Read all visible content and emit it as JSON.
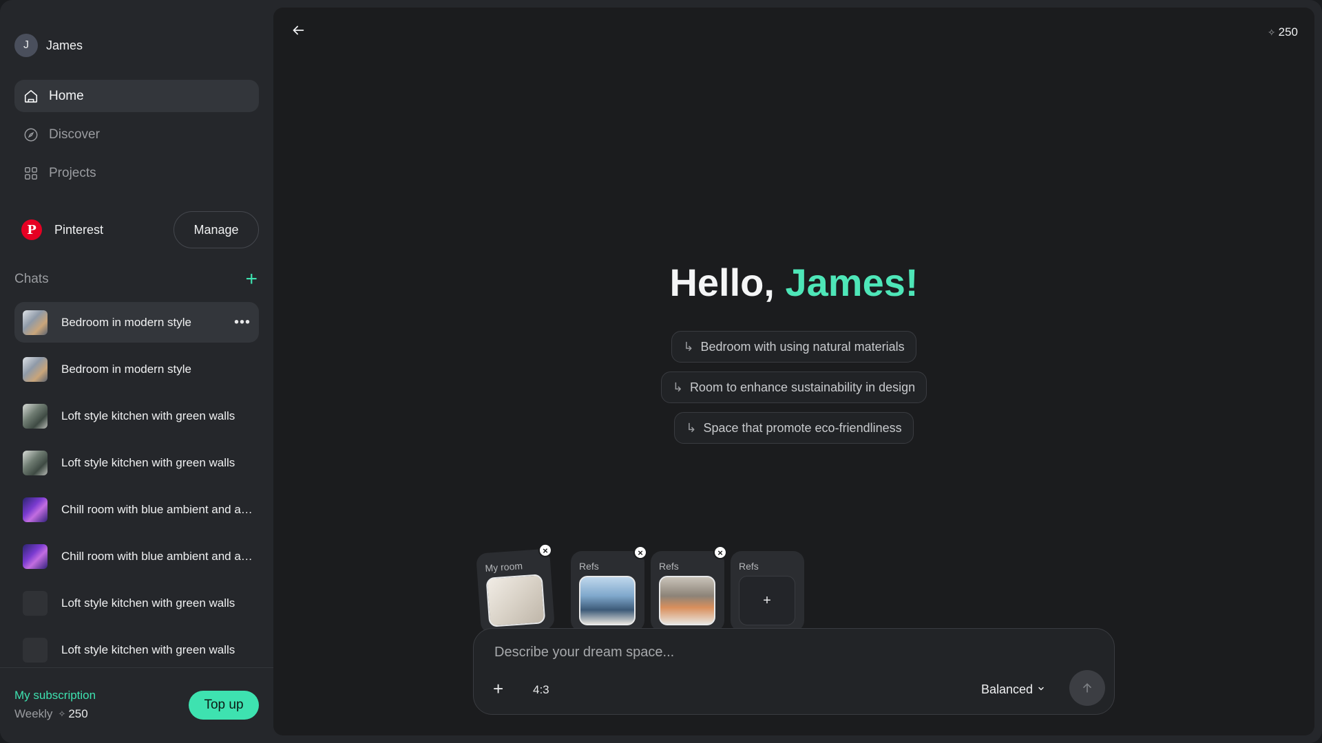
{
  "user": {
    "initial": "J",
    "name": "James"
  },
  "nav": [
    {
      "label": "Home",
      "icon": "home-icon",
      "active": true
    },
    {
      "label": "Discover",
      "icon": "compass-icon",
      "active": false
    },
    {
      "label": "Projects",
      "icon": "grid-icon",
      "active": false
    }
  ],
  "pinterest": {
    "label": "Pinterest",
    "manage_label": "Manage"
  },
  "chats": {
    "title": "Chats",
    "items": [
      {
        "label": "Bedroom in modern style",
        "thumb": "bedroom",
        "active": true
      },
      {
        "label": "Bedroom in modern style",
        "thumb": "bedroom",
        "active": false
      },
      {
        "label": "Loft style kitchen with green walls",
        "thumb": "kitchen",
        "active": false
      },
      {
        "label": "Loft style kitchen with green walls",
        "thumb": "kitchen",
        "active": false
      },
      {
        "label": "Chill room with blue ambient and a…",
        "thumb": "chill",
        "active": false
      },
      {
        "label": "Chill room with blue ambient and a…",
        "thumb": "chill",
        "active": false
      },
      {
        "label": "Loft style kitchen with green walls",
        "thumb": "empty",
        "active": false
      },
      {
        "label": "Loft style kitchen with green walls",
        "thumb": "empty",
        "active": false
      }
    ]
  },
  "subscription": {
    "title": "My subscription",
    "period": "Weekly",
    "amount": "250",
    "topup_label": "Top up"
  },
  "header": {
    "credits": "250"
  },
  "greeting": {
    "hello": "Hello, ",
    "name": "James!"
  },
  "suggestions": [
    "Bedroom with using natural materials",
    "Room to enhance sustainability in design",
    "Space that promote eco-friendliness"
  ],
  "cards": [
    {
      "label": "My room"
    },
    {
      "label": "Refs"
    },
    {
      "label": "Refs"
    },
    {
      "label": "Refs"
    }
  ],
  "composer": {
    "placeholder": "Describe your dream space...",
    "ratio": "4:3",
    "mode": "Balanced"
  },
  "colors": {
    "accent": "#3ee2b0",
    "pinterest": "#e60023"
  }
}
